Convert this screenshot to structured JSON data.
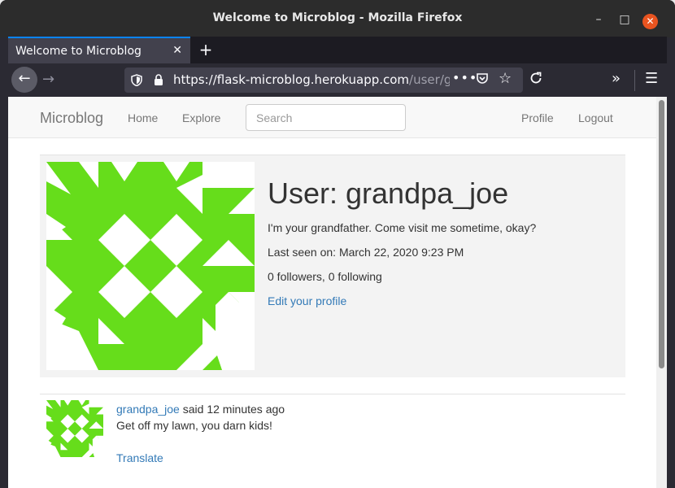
{
  "window": {
    "title": "Welcome to Microblog - Mozilla Firefox",
    "minimize_glyph": "–",
    "maximize_glyph": "□",
    "close_glyph": "✕"
  },
  "tab": {
    "label": "Welcome to Microblog",
    "close_glyph": "✕",
    "new_tab_glyph": "+"
  },
  "toolbar": {
    "back_glyph": "←",
    "forward_glyph": "→",
    "url_main": "https://flask-microblog.herokuapp.com",
    "url_rest": "/user/g",
    "page_actions_glyph": "•••",
    "bookmark_glyph": "☆",
    "overflow_glyph": "»",
    "menu_glyph": "☰"
  },
  "site": {
    "brand": "Microblog",
    "nav": {
      "home": "Home",
      "explore": "Explore",
      "profile": "Profile",
      "logout": "Logout"
    },
    "search_placeholder": "Search"
  },
  "profile": {
    "title": "User: grandpa_joe",
    "about": "I'm your grandfather. Come visit me sometime, okay?",
    "last_seen": "Last seen on: March 22, 2020 9:23 PM",
    "follow_counts": "0 followers, 0 following",
    "edit_link": "Edit your profile"
  },
  "post": {
    "author": "grandpa_joe",
    "said": " said 12 minutes ago",
    "body": "Get off my lawn, you darn kids!",
    "translate": "Translate"
  },
  "colors": {
    "identicon": "#66dd1b",
    "link": "#337ab7",
    "accent_tab": "#0a84ff",
    "close_button": "#e95420"
  }
}
